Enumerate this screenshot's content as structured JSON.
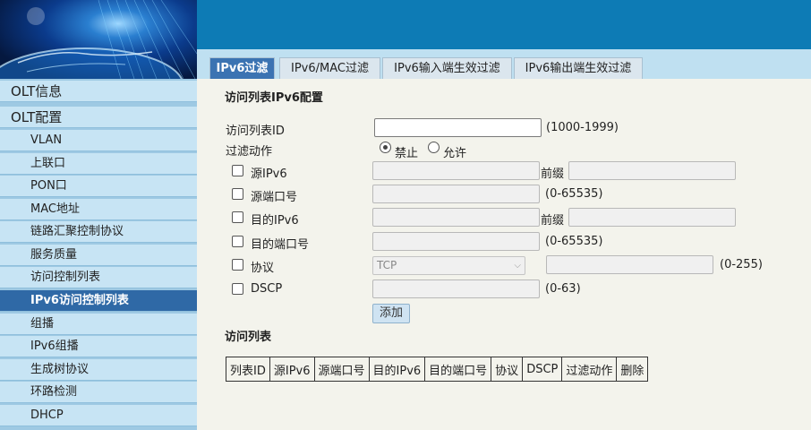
{
  "sidebar": {
    "items": [
      {
        "label": "OLT信息",
        "kind": "top"
      },
      {
        "label": "OLT配置",
        "kind": "top"
      },
      {
        "label": "VLAN",
        "kind": "sub"
      },
      {
        "label": "上联口",
        "kind": "sub"
      },
      {
        "label": "PON口",
        "kind": "sub"
      },
      {
        "label": "MAC地址",
        "kind": "sub"
      },
      {
        "label": "链路汇聚控制协议",
        "kind": "sub"
      },
      {
        "label": "服务质量",
        "kind": "sub"
      },
      {
        "label": "访问控制列表",
        "kind": "sub"
      },
      {
        "label": "IPv6访问控制列表",
        "kind": "sub",
        "active": true
      },
      {
        "label": "组播",
        "kind": "sub"
      },
      {
        "label": "IPv6组播",
        "kind": "sub"
      },
      {
        "label": "生成树协议",
        "kind": "sub"
      },
      {
        "label": "环路检测",
        "kind": "sub"
      },
      {
        "label": "DHCP",
        "kind": "sub"
      }
    ]
  },
  "tabs": [
    {
      "label": "IPv6过滤",
      "active": true
    },
    {
      "label": "IPv6/MAC过滤"
    },
    {
      "label": "IPv6输入端生效过滤"
    },
    {
      "label": "IPv6输出端生效过滤"
    }
  ],
  "form": {
    "section_title": "访问列表IPv6配置",
    "acl_id_label": "访问列表ID",
    "acl_id_value": "",
    "acl_id_range": "(1000-1999)",
    "action_label": "过滤动作",
    "action_deny": "禁止",
    "action_permit": "允许",
    "action_selected": "禁止",
    "src_ipv6_label": "源IPv6",
    "prefix_label": "前缀",
    "src_port_label": "源端口号",
    "port_range": "(0-65535)",
    "dst_ipv6_label": "目的IPv6",
    "dst_port_label": "目的端口号",
    "protocol_label": "协议",
    "protocol_value": "TCP",
    "protocol_range": "(0-255)",
    "dscp_label": "DSCP",
    "dscp_range": "(0-63)",
    "add_button": "添加"
  },
  "list": {
    "title": "访问列表",
    "columns": [
      "列表ID",
      "源IPv6",
      "源端口号",
      "目的IPv6",
      "目的端口号",
      "协议",
      "DSCP",
      "过滤动作",
      "删除"
    ]
  },
  "colors": {
    "banner": "#0d7bb5",
    "sidebar_active": "#2f69a6",
    "tab_active": "#3b73b2",
    "main_bg": "#f3f3ec"
  }
}
